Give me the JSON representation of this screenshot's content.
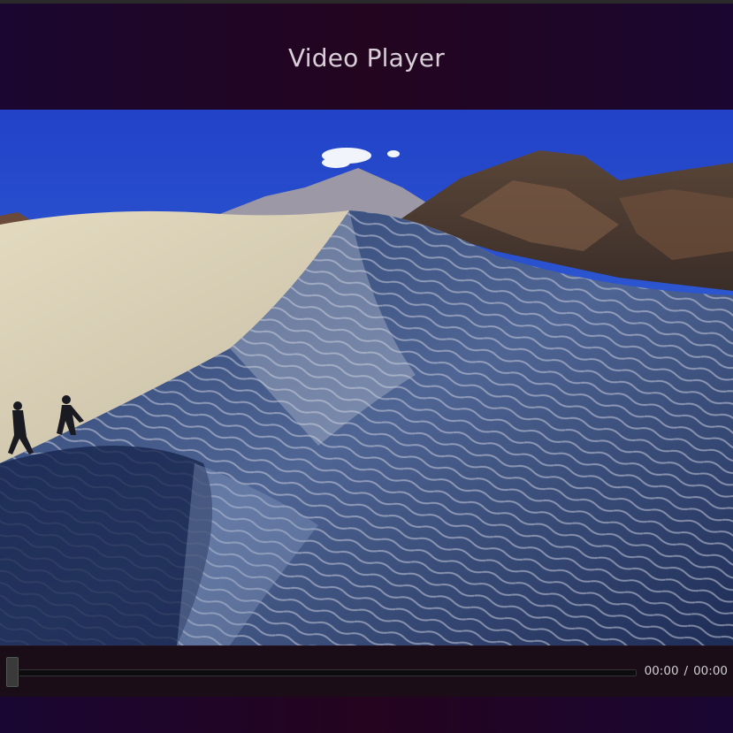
{
  "header": {
    "title": "Video Player"
  },
  "player": {
    "current_time": "00:00",
    "separator": "/",
    "duration": "00:00",
    "progress": 0
  }
}
